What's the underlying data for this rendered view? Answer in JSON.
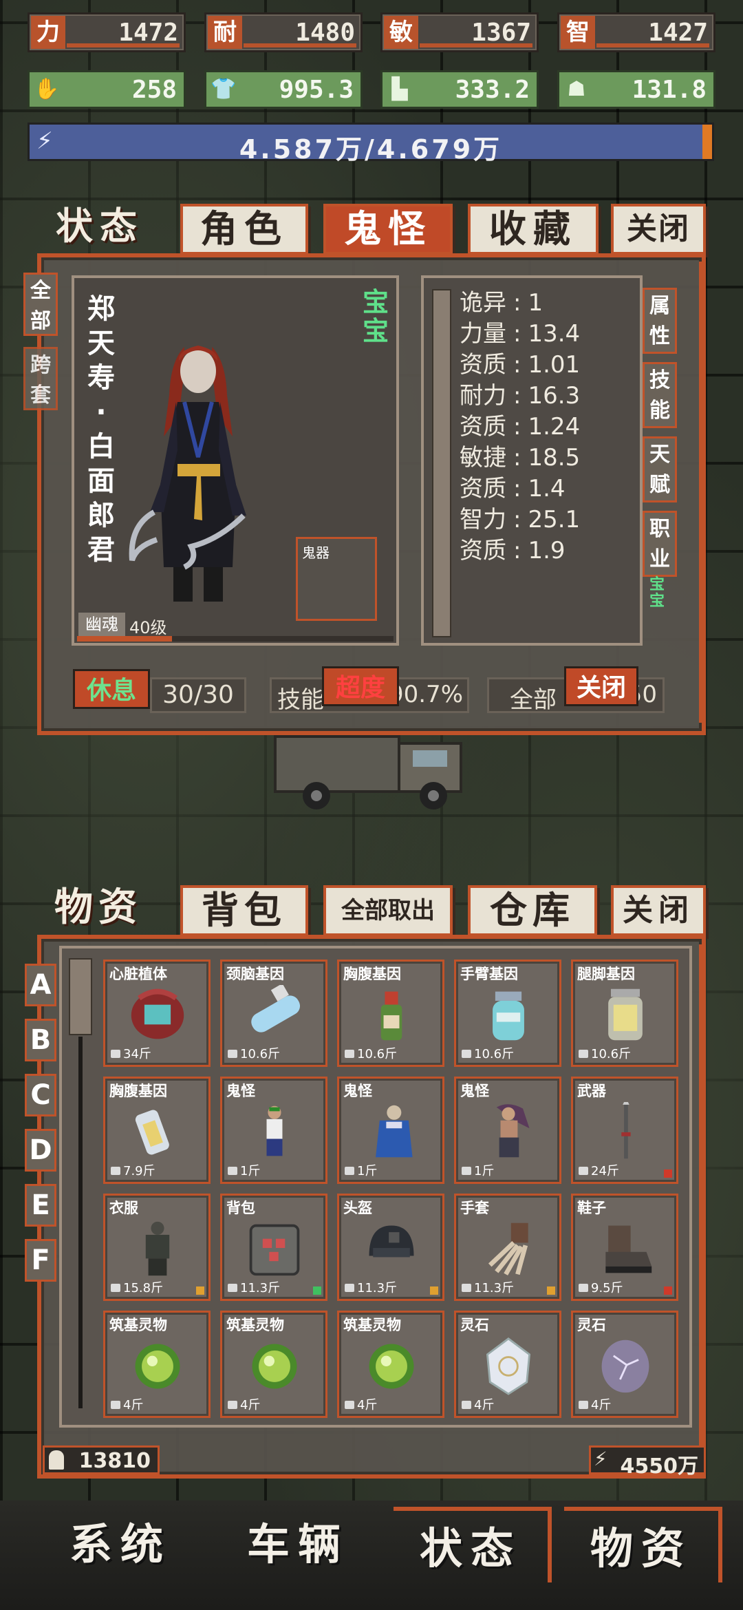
{
  "top_stats": [
    {
      "label": "力",
      "value": "1472"
    },
    {
      "label": "耐",
      "value": "1480"
    },
    {
      "label": "敏",
      "value": "1367"
    },
    {
      "label": "智",
      "value": "1427"
    }
  ],
  "resources": [
    {
      "icon": "hand-icon",
      "value": "258"
    },
    {
      "icon": "shirt-icon",
      "value": "995.3"
    },
    {
      "icon": "boot-icon",
      "value": "333.2"
    },
    {
      "icon": "ghost-icon",
      "value": "131.8"
    }
  ],
  "energy": {
    "text": "4.587万/4.679万",
    "fill": 0.98
  },
  "status_tabs": [
    "状态",
    "角色",
    "鬼怪",
    "收藏",
    "关闭"
  ],
  "left_side_tabs": [
    "全部",
    "跨套"
  ],
  "character": {
    "name_lines": [
      "郑",
      "天",
      "寿",
      "·",
      "白",
      "面",
      "郎",
      "君"
    ],
    "tag": "宝宝",
    "equip_slot_label": "鬼器",
    "type_label": "幽魂",
    "level": "40级"
  },
  "attributes": [
    {
      "name": "诡异",
      "value": "1"
    },
    {
      "name": "力量",
      "value": "13.4"
    },
    {
      "name": "资质",
      "value": "1.01"
    },
    {
      "name": "耐力",
      "value": "16.3"
    },
    {
      "name": "资质",
      "value": "1.24"
    },
    {
      "name": "敏捷",
      "value": "18.5"
    },
    {
      "name": "资质",
      "value": "1.4"
    },
    {
      "name": "智力",
      "value": "25.1"
    },
    {
      "name": "资质",
      "value": "1.9"
    }
  ],
  "right_side_tabs": [
    "属性",
    "技能",
    "天赋",
    "职业"
  ],
  "right_side_tag": "宝宝",
  "status_bottom": {
    "rest_btn": "休息",
    "rest_count": "30/30",
    "skill_label": "技能",
    "overload_btn": "超度",
    "percent": "90.7%",
    "all_label": "全部",
    "close_btn": "关闭",
    "tail": "50"
  },
  "material_tabs": [
    "物资",
    "背包",
    "全部取出",
    "仓库",
    "关闭"
  ],
  "row_letters": [
    "A",
    "B",
    "C",
    "D",
    "E",
    "F"
  ],
  "items": [
    {
      "name": "心脏植体",
      "weight": "34斤",
      "art": "heart",
      "dot": ""
    },
    {
      "name": "颈脑基因",
      "weight": "10.6斤",
      "art": "vial",
      "dot": ""
    },
    {
      "name": "胸腹基因",
      "weight": "10.6斤",
      "art": "bottle",
      "dot": ""
    },
    {
      "name": "手臂基因",
      "weight": "10.6斤",
      "art": "jar",
      "dot": ""
    },
    {
      "name": "腿脚基因",
      "weight": "10.6斤",
      "art": "can",
      "dot": ""
    },
    {
      "name": "胸腹基因",
      "weight": "7.9斤",
      "art": "inhaler",
      "dot": ""
    },
    {
      "name": "鬼怪",
      "weight": "1斤",
      "art": "fighter",
      "dot": ""
    },
    {
      "name": "鬼怪",
      "weight": "1斤",
      "art": "robe",
      "dot": ""
    },
    {
      "name": "鬼怪",
      "weight": "1斤",
      "art": "longhair",
      "dot": ""
    },
    {
      "name": "武器",
      "weight": "24斤",
      "art": "spear",
      "dot": "#d03a2a"
    },
    {
      "name": "衣服",
      "weight": "15.8斤",
      "art": "armor",
      "dot": "#e0a030"
    },
    {
      "name": "背包",
      "weight": "11.3斤",
      "art": "pack",
      "dot": "#40c060"
    },
    {
      "name": "头盔",
      "weight": "11.3斤",
      "art": "helmet",
      "dot": "#e0a030"
    },
    {
      "name": "手套",
      "weight": "11.3斤",
      "art": "claw",
      "dot": "#e0a030"
    },
    {
      "name": "鞋子",
      "weight": "9.5斤",
      "art": "shoe",
      "dot": "#d03a2a"
    },
    {
      "name": "筑基灵物",
      "weight": "4斤",
      "art": "orb",
      "dot": ""
    },
    {
      "name": "筑基灵物",
      "weight": "4斤",
      "art": "orb",
      "dot": ""
    },
    {
      "name": "筑基灵物",
      "weight": "4斤",
      "art": "orb",
      "dot": ""
    },
    {
      "name": "灵石",
      "weight": "4斤",
      "art": "crystal",
      "dot": ""
    },
    {
      "name": "灵石",
      "weight": "4斤",
      "art": "stone",
      "dot": ""
    }
  ],
  "footer": {
    "left_value": "13810",
    "right_value": "4550万"
  },
  "nav": [
    "系统",
    "车辆",
    "状态",
    "物资"
  ]
}
